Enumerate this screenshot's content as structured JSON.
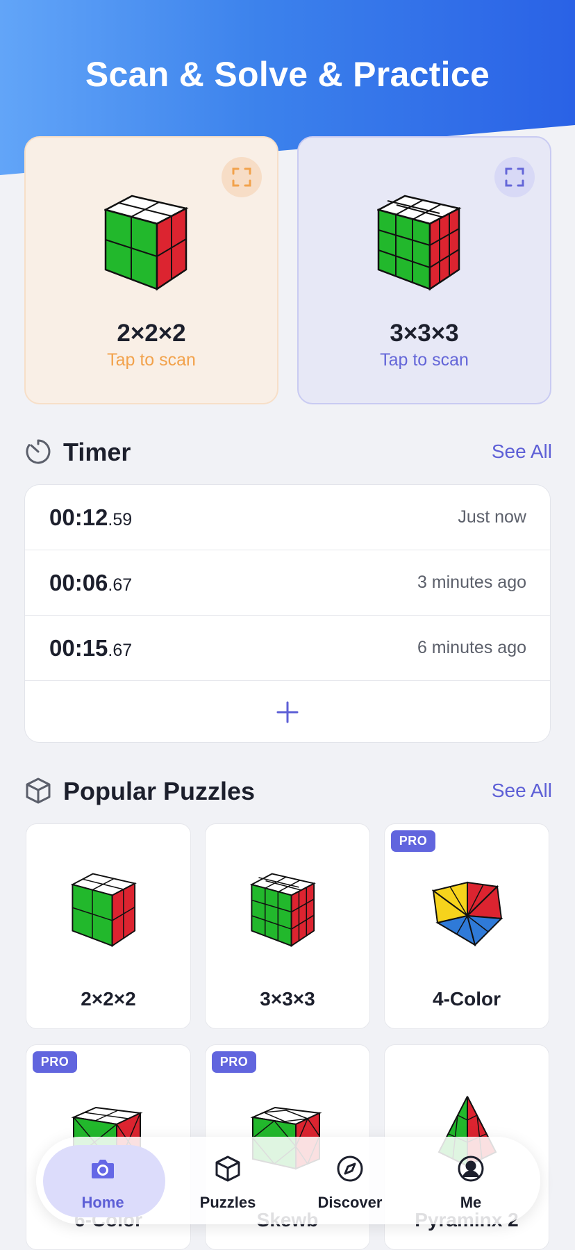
{
  "header": {
    "title": "Scan & Solve & Practice"
  },
  "scan_cards": [
    {
      "name": "2×2×2",
      "subtitle": "Tap to scan",
      "icon": "scan-frame-icon",
      "accent": "#f2a24c"
    },
    {
      "name": "3×3×3",
      "subtitle": "Tap to scan",
      "icon": "scan-frame-icon",
      "accent": "#6466d8"
    }
  ],
  "timer": {
    "title": "Timer",
    "icon": "stopwatch-icon",
    "see_all": "See All",
    "rows": [
      {
        "main": "00:12",
        "fraction": ".59",
        "when": "Just now"
      },
      {
        "main": "00:06",
        "fraction": ".67",
        "when": "3 minutes ago"
      },
      {
        "main": "00:15",
        "fraction": ".67",
        "when": "6 minutes ago"
      }
    ],
    "add_icon": "plus-icon"
  },
  "popular": {
    "title": "Popular Puzzles",
    "icon": "cube-outline-icon",
    "see_all": "See All",
    "badge": "PRO",
    "items": [
      {
        "name": "2×2×2",
        "pro": false,
        "icon": "cube-2x2-icon"
      },
      {
        "name": "3×3×3",
        "pro": false,
        "icon": "cube-3x3-icon"
      },
      {
        "name": "4-Color",
        "pro": true,
        "icon": "four-color-icon"
      },
      {
        "name": "6-Color",
        "pro": true,
        "icon": "six-color-icon"
      },
      {
        "name": "Skewb",
        "pro": true,
        "icon": "skewb-icon"
      },
      {
        "name": "Pyraminx 2",
        "pro": false,
        "icon": "pyraminx-icon"
      }
    ]
  },
  "tabs": [
    {
      "label": "Home",
      "icon": "camera-icon",
      "active": true
    },
    {
      "label": "Puzzles",
      "icon": "cube-icon",
      "active": false
    },
    {
      "label": "Discover",
      "icon": "compass-icon",
      "active": false
    },
    {
      "label": "Me",
      "icon": "profile-icon",
      "active": false
    }
  ],
  "colors": {
    "accent": "#5d5fd6",
    "cube_green": "#22b82c",
    "cube_red": "#dc2430",
    "cube_white": "#ffffff",
    "cube_yellow": "#f6d31c",
    "cube_blue": "#2f7ad8"
  }
}
